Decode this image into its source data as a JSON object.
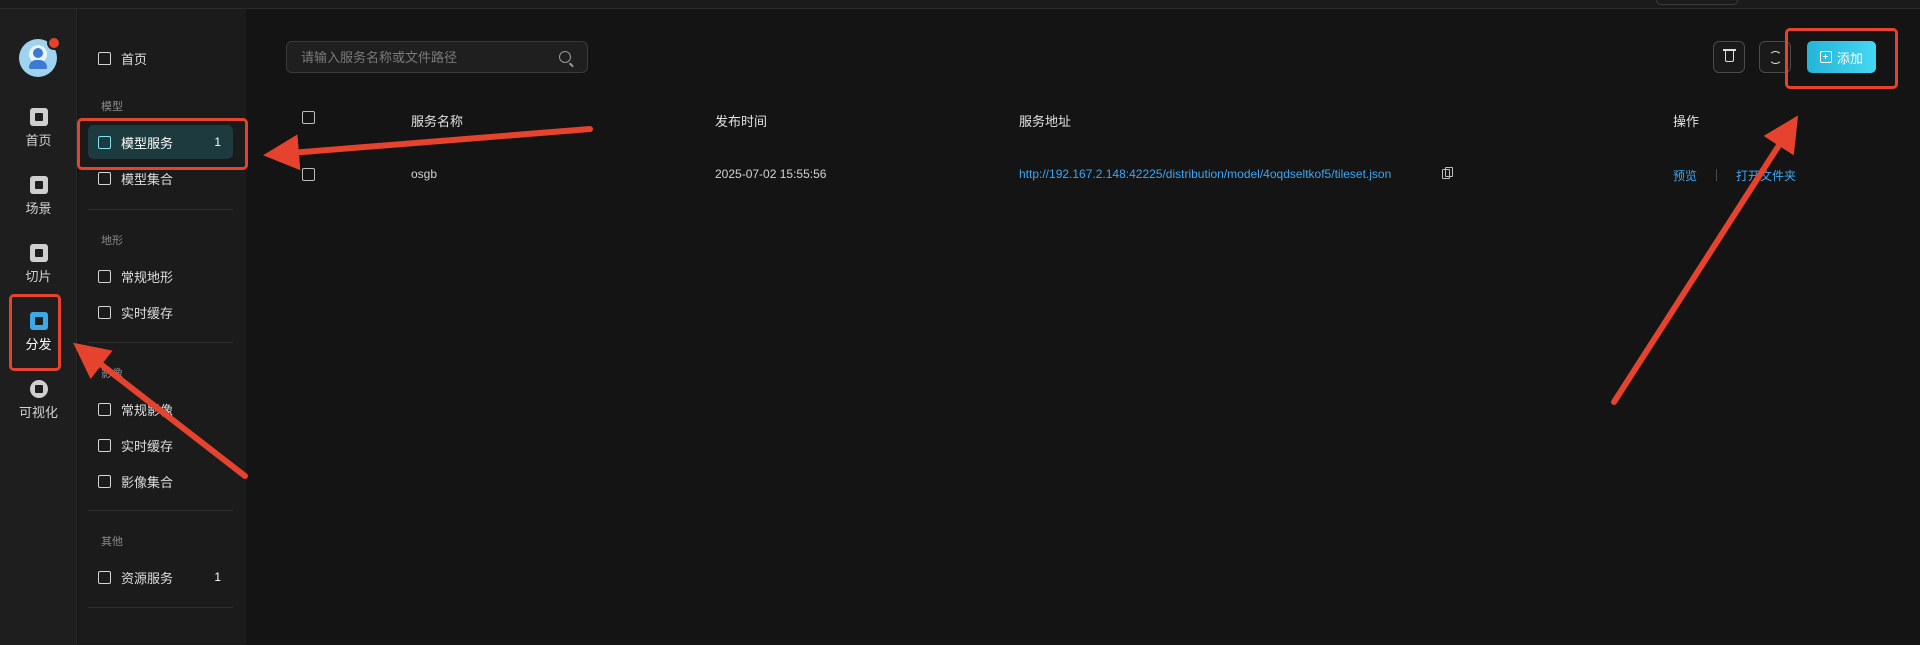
{
  "rail": {
    "items": [
      {
        "label": "首页",
        "icon": "home-icon"
      },
      {
        "label": "场景",
        "icon": "cube-icon"
      },
      {
        "label": "切片",
        "icon": "slice-icon"
      },
      {
        "label": "分发",
        "icon": "distribute-icon",
        "active": true
      },
      {
        "label": "可视化",
        "icon": "visualize-icon"
      }
    ]
  },
  "sidebar": {
    "home": "首页",
    "groups": {
      "model": "模型",
      "terrain": "地形",
      "imagery": "影像",
      "other": "其他"
    },
    "items": {
      "model_service": {
        "label": "模型服务",
        "badge": "1"
      },
      "model_collection": {
        "label": "模型集合"
      },
      "terrain_normal": {
        "label": "常规地形"
      },
      "terrain_cache": {
        "label": "实时缓存"
      },
      "imagery_normal": {
        "label": "常规影像"
      },
      "imagery_cache": {
        "label": "实时缓存"
      },
      "imagery_collection": {
        "label": "影像集合"
      },
      "resource_service": {
        "label": "资源服务",
        "badge": "1"
      }
    }
  },
  "toolbar": {
    "search_placeholder": "请输入服务名称或文件路径",
    "add_label": "添加"
  },
  "table": {
    "headers": {
      "name": "服务名称",
      "time": "发布时间",
      "url": "服务地址",
      "ops": "操作"
    },
    "rows": [
      {
        "name": "osgb",
        "time": "2025-07-02 15:55:56",
        "url": "http://192.167.2.148:42225/distribution/model/4oqdseltkof5/tileset.json",
        "op_preview": "预览",
        "op_open": "打开文件夹"
      }
    ]
  },
  "colors": {
    "accent": "#3ba6f5",
    "add_button": "#2fc3e3",
    "annotation": "#e5432d",
    "active_nav_bg": "#1d3a3f"
  }
}
